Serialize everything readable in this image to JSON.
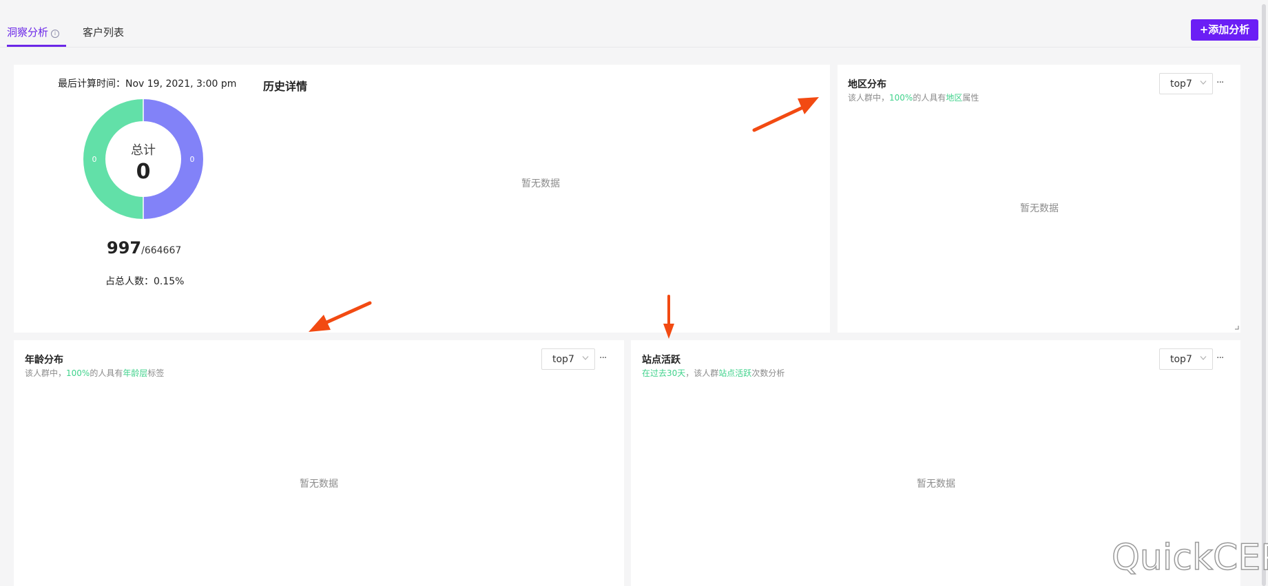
{
  "tabs": {
    "insight_label": "洞察分析",
    "customer_list_label": "客户列表"
  },
  "header": {
    "add_button_label": "+添加分析"
  },
  "summary": {
    "calc_time_label": "最后计算时间：",
    "calc_time_value": "Nov 19, 2021, 3:00 pm",
    "donut_center_label": "总计",
    "donut_center_value": "0",
    "donut_left_value": "0",
    "donut_right_value": "0",
    "donut_colors": {
      "left": "#62e0a8",
      "right": "#8282f8"
    },
    "count": "997",
    "total": "/664667",
    "share_label": "占总人数：",
    "share_value": "0.15%"
  },
  "history": {
    "title": "历史详情",
    "empty": "暂无数据"
  },
  "region": {
    "title": "地区分布",
    "sub_prefix": "该人群中，",
    "sub_pct": "100%",
    "sub_mid": "的人具有",
    "sub_attr": "地区",
    "sub_suffix": "属性",
    "select_value": "top7",
    "more": "···",
    "empty": "暂无数据"
  },
  "age": {
    "title": "年龄分布",
    "sub_prefix": "该人群中，",
    "sub_pct": "100%",
    "sub_mid": "的人具有",
    "sub_attr": "年龄层",
    "sub_suffix": "标签",
    "select_value": "top7",
    "more": "···",
    "empty": "暂无数据"
  },
  "site": {
    "title": "站点活跃",
    "sub_period": "在过去30天",
    "sub_mid": "，该人群",
    "sub_attr": "站点活跃",
    "sub_suffix": "次数分析",
    "select_value": "top7",
    "more": "···",
    "empty": "暂无数据"
  },
  "accent_color": "#6b1ff5",
  "highlight_color": "#3fd28b",
  "annotation_arrow_color": "#f24a12",
  "watermark": "QuickCEP"
}
